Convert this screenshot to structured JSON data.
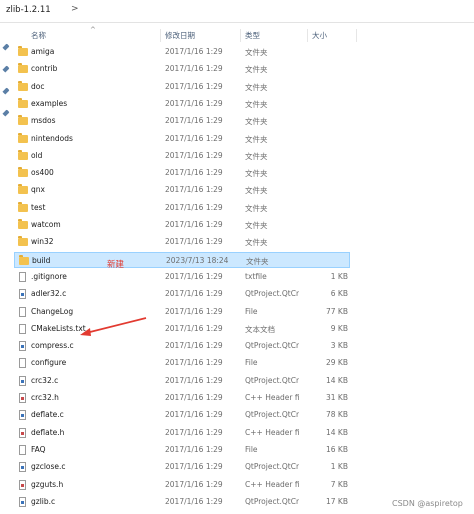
{
  "address": {
    "path": "zlib-1.2.11",
    "separator": ">"
  },
  "header": {
    "chevron": "^",
    "name": "名称",
    "date": "修改日期",
    "type": "类型",
    "size": "大小"
  },
  "accent_colors": {
    "selection": "#cce8ff",
    "annotation": "#e23a30",
    "folder": "#f3c24f"
  },
  "rows": [
    {
      "name": "amiga",
      "date": "2017/1/16 1:29",
      "type": "文件夹",
      "size": "",
      "icon": "folder-icon"
    },
    {
      "name": "contrib",
      "date": "2017/1/16 1:29",
      "type": "文件夹",
      "size": "",
      "icon": "folder-icon"
    },
    {
      "name": "doc",
      "date": "2017/1/16 1:29",
      "type": "文件夹",
      "size": "",
      "icon": "folder-icon"
    },
    {
      "name": "examples",
      "date": "2017/1/16 1:29",
      "type": "文件夹",
      "size": "",
      "icon": "folder-icon"
    },
    {
      "name": "msdos",
      "date": "2017/1/16 1:29",
      "type": "文件夹",
      "size": "",
      "icon": "folder-icon"
    },
    {
      "name": "nintendods",
      "date": "2017/1/16 1:29",
      "type": "文件夹",
      "size": "",
      "icon": "folder-icon"
    },
    {
      "name": "old",
      "date": "2017/1/16 1:29",
      "type": "文件夹",
      "size": "",
      "icon": "folder-icon"
    },
    {
      "name": "os400",
      "date": "2017/1/16 1:29",
      "type": "文件夹",
      "size": "",
      "icon": "folder-icon"
    },
    {
      "name": "qnx",
      "date": "2017/1/16 1:29",
      "type": "文件夹",
      "size": "",
      "icon": "folder-icon"
    },
    {
      "name": "test",
      "date": "2017/1/16 1:29",
      "type": "文件夹",
      "size": "",
      "icon": "folder-icon"
    },
    {
      "name": "watcom",
      "date": "2017/1/16 1:29",
      "type": "文件夹",
      "size": "",
      "icon": "folder-icon"
    },
    {
      "name": "win32",
      "date": "2017/1/16 1:29",
      "type": "文件夹",
      "size": "",
      "icon": "folder-icon"
    },
    {
      "name": "build",
      "date": "2023/7/13 18:24",
      "type": "文件夹",
      "size": "",
      "icon": "folder-icon",
      "selected": true
    },
    {
      "name": ".gitignore",
      "date": "2017/1/16 1:29",
      "type": "txtfile",
      "size": "1 KB",
      "icon": "file-icon"
    },
    {
      "name": "adler32.c",
      "date": "2017/1/16 1:29",
      "type": "QtProject.QtCre...",
      "size": "6 KB",
      "icon": "c-file-icon"
    },
    {
      "name": "ChangeLog",
      "date": "2017/1/16 1:29",
      "type": "File",
      "size": "77 KB",
      "icon": "file-icon"
    },
    {
      "name": "CMakeLists.txt",
      "date": "2017/1/16 1:29",
      "type": "文本文档",
      "size": "9 KB",
      "icon": "file-icon"
    },
    {
      "name": "compress.c",
      "date": "2017/1/16 1:29",
      "type": "QtProject.QtCre...",
      "size": "3 KB",
      "icon": "c-file-icon"
    },
    {
      "name": "configure",
      "date": "2017/1/16 1:29",
      "type": "File",
      "size": "29 KB",
      "icon": "file-icon"
    },
    {
      "name": "crc32.c",
      "date": "2017/1/16 1:29",
      "type": "QtProject.QtCre...",
      "size": "14 KB",
      "icon": "c-file-icon"
    },
    {
      "name": "crc32.h",
      "date": "2017/1/16 1:29",
      "type": "C++ Header file",
      "size": "31 KB",
      "icon": "h-file-icon"
    },
    {
      "name": "deflate.c",
      "date": "2017/1/16 1:29",
      "type": "QtProject.QtCre...",
      "size": "78 KB",
      "icon": "c-file-icon"
    },
    {
      "name": "deflate.h",
      "date": "2017/1/16 1:29",
      "type": "C++ Header file",
      "size": "14 KB",
      "icon": "h-file-icon"
    },
    {
      "name": "FAQ",
      "date": "2017/1/16 1:29",
      "type": "File",
      "size": "16 KB",
      "icon": "file-icon"
    },
    {
      "name": "gzclose.c",
      "date": "2017/1/16 1:29",
      "type": "QtProject.QtCre...",
      "size": "1 KB",
      "icon": "c-file-icon"
    },
    {
      "name": "gzguts.h",
      "date": "2017/1/16 1:29",
      "type": "C++ Header file",
      "size": "7 KB",
      "icon": "h-file-icon"
    },
    {
      "name": "gzlib.c",
      "date": "2017/1/16 1:29",
      "type": "QtProject.QtCre...",
      "size": "17 KB",
      "icon": "c-file-icon"
    }
  ],
  "annotation": {
    "label": "新建"
  },
  "watermark": "CSDN @aspiretop"
}
